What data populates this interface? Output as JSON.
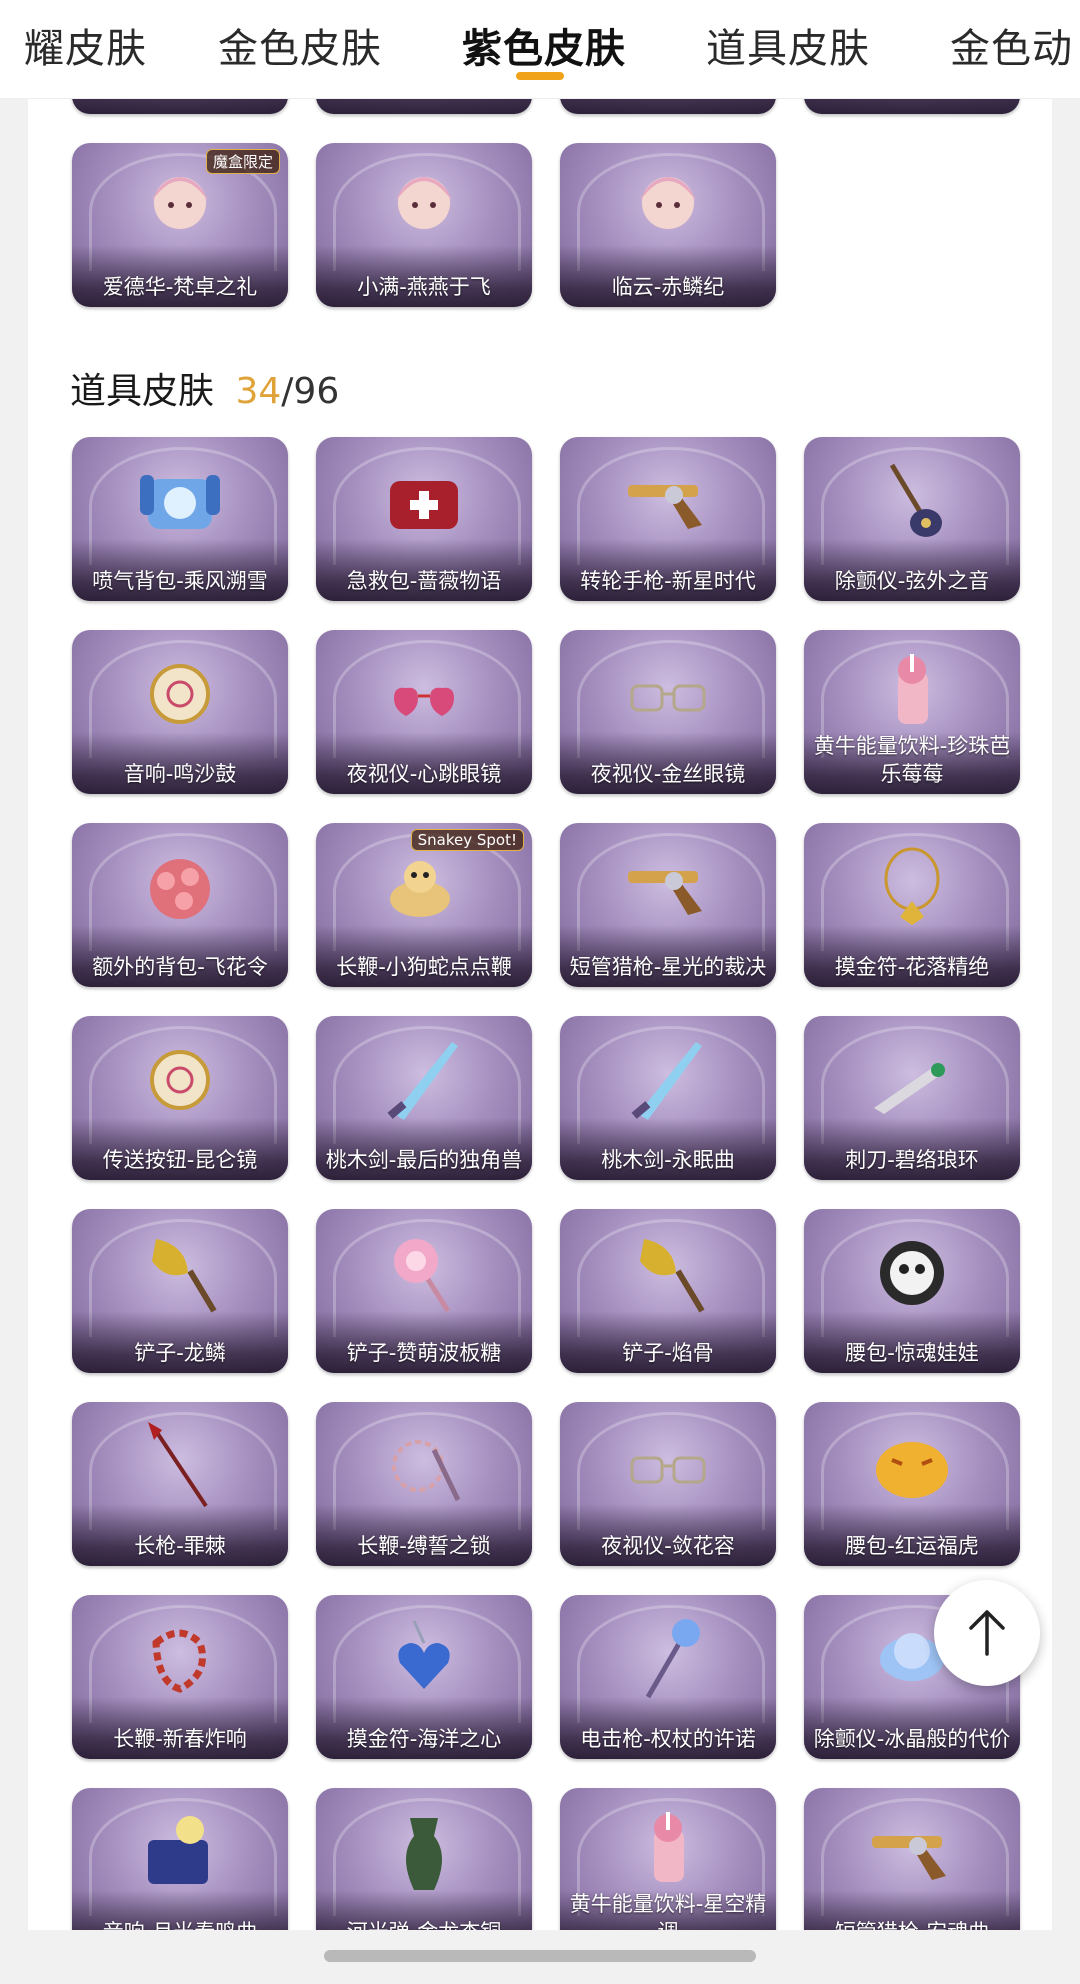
{
  "tabs": [
    {
      "label": "耀皮肤",
      "active": false
    },
    {
      "label": "金色皮肤",
      "active": false
    },
    {
      "label": "紫色皮肤",
      "active": true
    },
    {
      "label": "道具皮肤",
      "active": false
    },
    {
      "label": "金色动"
    }
  ],
  "character_skins": [
    {
      "label": "爱德华-梵卓之礼",
      "badge": "魔盒限定",
      "icon": "character-portrait-icon"
    },
    {
      "label": "小满-燕燕于飞",
      "icon": "character-portrait-icon"
    },
    {
      "label": "临云-赤鳞纪",
      "icon": "character-portrait-icon"
    }
  ],
  "prop_section": {
    "title": "道具皮肤",
    "owned": "34",
    "separator": "/",
    "total": "96"
  },
  "prop_skins": [
    {
      "label": "喷气背包-乘风溯雪",
      "icon": "jetpack-icon"
    },
    {
      "label": "急救包-蔷薇物语",
      "icon": "medkit-icon"
    },
    {
      "label": "转轮手枪-新星时代",
      "icon": "revolver-icon"
    },
    {
      "label": "除颤仪-弦外之音",
      "icon": "lute-icon"
    },
    {
      "label": "音响-鸣沙鼓",
      "icon": "drum-icon"
    },
    {
      "label": "夜视仪-心跳眼镜",
      "icon": "heart-glasses-icon"
    },
    {
      "label": "夜视仪-金丝眼镜",
      "icon": "glasses-icon"
    },
    {
      "label": "黄牛能量饮料-珍珠芭乐莓莓",
      "icon": "drink-icon"
    },
    {
      "label": "额外的背包-飞花令",
      "icon": "flower-bag-icon"
    },
    {
      "label": "长鞭-小狗蛇点点鞭",
      "badge": "Snakey Spot!",
      "icon": "snake-icon"
    },
    {
      "label": "短管猎枪-星光的裁决",
      "icon": "shotgun-icon"
    },
    {
      "label": "摸金符-花落精绝",
      "icon": "amulet-icon"
    },
    {
      "label": "传送按钮-昆仑镜",
      "icon": "mirror-icon"
    },
    {
      "label": "桃木剑-最后的独角兽",
      "icon": "sword-icon"
    },
    {
      "label": "桃木剑-永眠曲",
      "icon": "sword-icon"
    },
    {
      "label": "刺刀-碧络琅环",
      "icon": "dagger-icon"
    },
    {
      "label": "铲子-龙鳞",
      "icon": "shovel-icon"
    },
    {
      "label": "铲子-赞萌波板糖",
      "icon": "lollipop-icon"
    },
    {
      "label": "铲子-焰骨",
      "icon": "shovel-icon"
    },
    {
      "label": "腰包-惊魂娃娃",
      "icon": "skull-doll-icon"
    },
    {
      "label": "长枪-罪棘",
      "icon": "spear-icon"
    },
    {
      "label": "长鞭-缚誓之锁",
      "icon": "chain-icon"
    },
    {
      "label": "夜视仪-敛花容",
      "icon": "flower-glasses-icon"
    },
    {
      "label": "腰包-红运福虎",
      "icon": "tiger-bag-icon"
    },
    {
      "label": "长鞭-新春炸响",
      "icon": "firecracker-icon"
    },
    {
      "label": "摸金符-海洋之心",
      "icon": "heart-gem-icon"
    },
    {
      "label": "电击枪-权杖的许诺",
      "icon": "scepter-icon"
    },
    {
      "label": "除颤仪-冰晶般的代价",
      "icon": "ice-lotus-icon"
    },
    {
      "label": "音响-月光奏鸣曲",
      "icon": "piano-icon"
    },
    {
      "label": "河光弹-金龙杏铜",
      "icon": "vase-icon"
    },
    {
      "label": "黄牛能量饮料-星空精调",
      "icon": "drink-icon"
    },
    {
      "label": "短管猎枪-安魂曲",
      "icon": "shotgun-icon"
    }
  ],
  "scroll_top": {
    "icon": "arrow-up-icon"
  },
  "colors": {
    "accent": "#f0a21a",
    "owned_count": "#e0a33a",
    "card_purple": "#a690c0"
  }
}
